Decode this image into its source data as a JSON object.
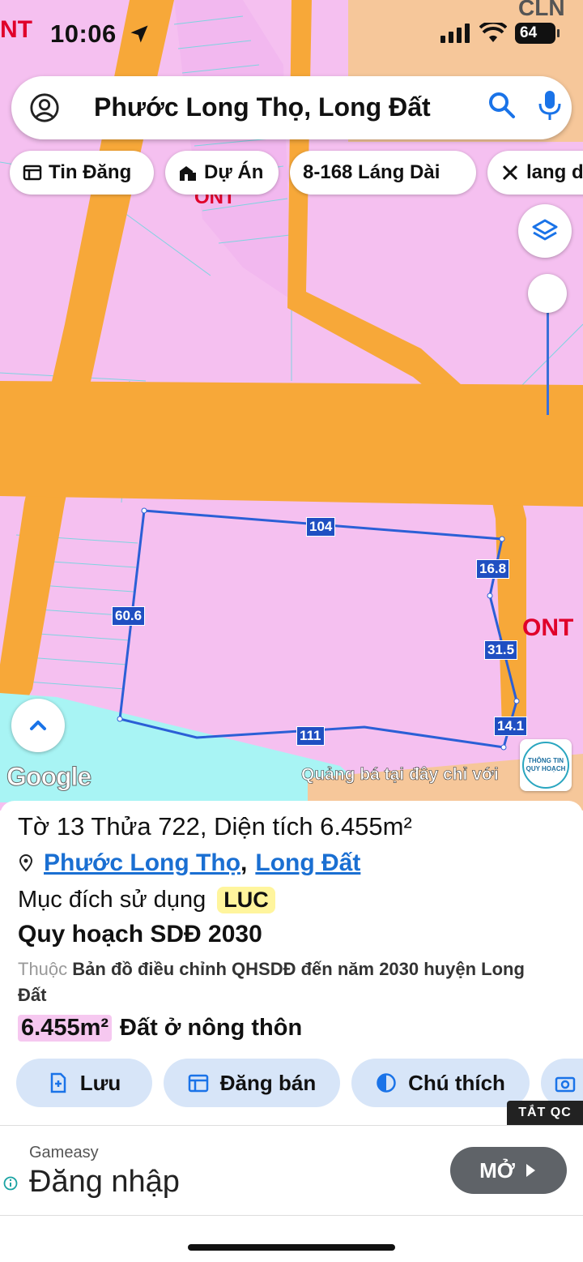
{
  "status_bar": {
    "time": "10:06",
    "battery": "64"
  },
  "search": {
    "text": "Phước Long Thọ, Long Đất"
  },
  "chips": [
    {
      "label": "Tin Đăng",
      "icon": "listing-icon"
    },
    {
      "label": "Dự Án",
      "icon": "building-icon"
    },
    {
      "label": "8-168 Láng Dài",
      "icon": ""
    },
    {
      "label": "lang d",
      "icon": "ruler-icon"
    }
  ],
  "map": {
    "labels": {
      "top_right": "CLN",
      "top_left": "NT",
      "upper": "ONT",
      "right": "ONT"
    },
    "dimensions": {
      "top": "104",
      "right_top": "16.8",
      "left": "60.6",
      "right_mid": "31.5",
      "right_bottom": "14.1",
      "bottom": "111"
    },
    "google": "Google",
    "ad_strip": "Quảng bá tại đây chỉ với",
    "badge_line1": "THÔNG TIN",
    "badge_line2": "QUY HOẠCH",
    "colors": {
      "land": "#f5c0f0",
      "road": "#f7a839",
      "water": "#a8f4f4",
      "boundary": "#2b5fd6"
    }
  },
  "parcel": {
    "title": "Tờ 13 Thửa 722, Diện tích 6.455m²",
    "ward": "Phước Long Thọ",
    "separator": ",",
    "district": "Long Đất",
    "purpose_label": "Mục đích sử dụng",
    "purpose_code": "LUC",
    "plan_title": "Quy hoạch SDĐ 2030",
    "belong_prefix": "Thuộc",
    "belong_text": "Bản đồ điều chỉnh QHSDĐ đến năm 2030 huyện Long Đất",
    "area_value": "6.455m²",
    "area_type": "Đất ở nông thôn"
  },
  "actions": [
    {
      "label": "Lưu",
      "icon": "bookmark-add-icon"
    },
    {
      "label": "Đăng bán",
      "icon": "calendar-icon"
    },
    {
      "label": "Chú thích",
      "icon": "contrast-icon"
    },
    {
      "label": "",
      "icon": "camera-add-icon"
    }
  ],
  "ad": {
    "close_label": "TẮT QC",
    "brand": "Gameasy",
    "title": "Đăng nhập",
    "button": "MỞ"
  }
}
